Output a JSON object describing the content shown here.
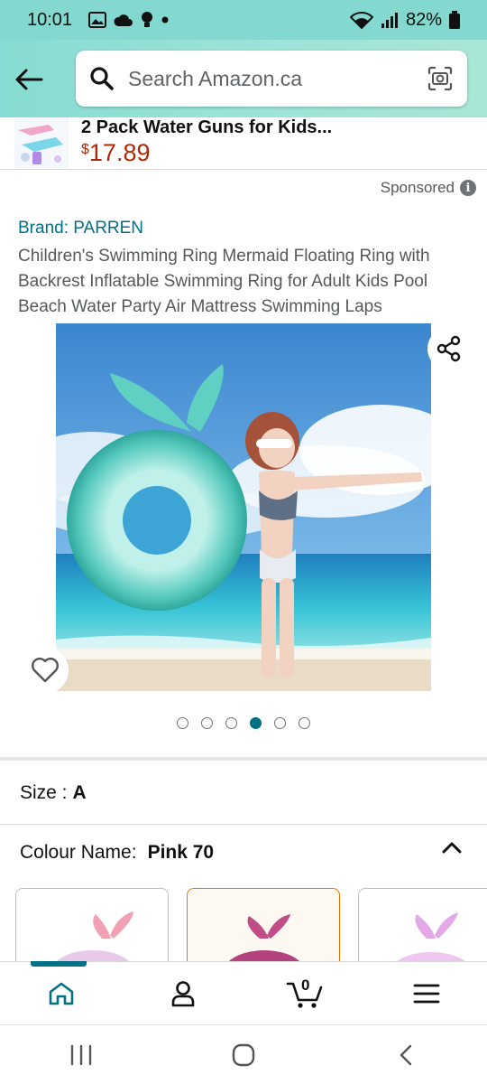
{
  "status_bar": {
    "time": "10:01",
    "battery": "82%",
    "icons": [
      "gallery-icon",
      "cloud-icon",
      "bulb-icon",
      "dot-icon",
      "wifi-icon",
      "signal-icon",
      "battery-icon"
    ]
  },
  "header": {
    "search_placeholder": "Search Amazon.ca",
    "icons": [
      "back-arrow-icon",
      "search-icon",
      "camera-icon"
    ]
  },
  "banner": {
    "title": "2 Pack Water Guns for Kids...",
    "price_currency": "$",
    "price_value": "17.89"
  },
  "sponsored": {
    "label": "Sponsored"
  },
  "product": {
    "brand": "Brand: PARREN",
    "title": "Children's Swimming Ring Mermaid Floating Ring with Backrest Inflatable Swimming Ring for Adult Kids Pool Beach Water Party Air Mattress Swimming Laps",
    "image_count": 6,
    "active_image_index": 3
  },
  "size": {
    "label": "Size :",
    "value": "A"
  },
  "colour": {
    "label": "Colour Name:",
    "value": "Pink 70",
    "swatches": [
      "pink-white",
      "pink",
      "lilac"
    ],
    "selected_swatch_index": 1
  },
  "bottom_nav": {
    "items": [
      "home-icon",
      "account-icon",
      "cart-icon",
      "menu-icon"
    ],
    "cart_count": "0",
    "active_index": 0
  },
  "android_nav": {
    "items": [
      "recents-icon",
      "home-button-icon",
      "back-icon"
    ]
  },
  "colors": {
    "accent_teal": "#007185",
    "price_red": "#b12704",
    "selected_orange": "#e77600",
    "header_teal": "#86dcd2"
  }
}
